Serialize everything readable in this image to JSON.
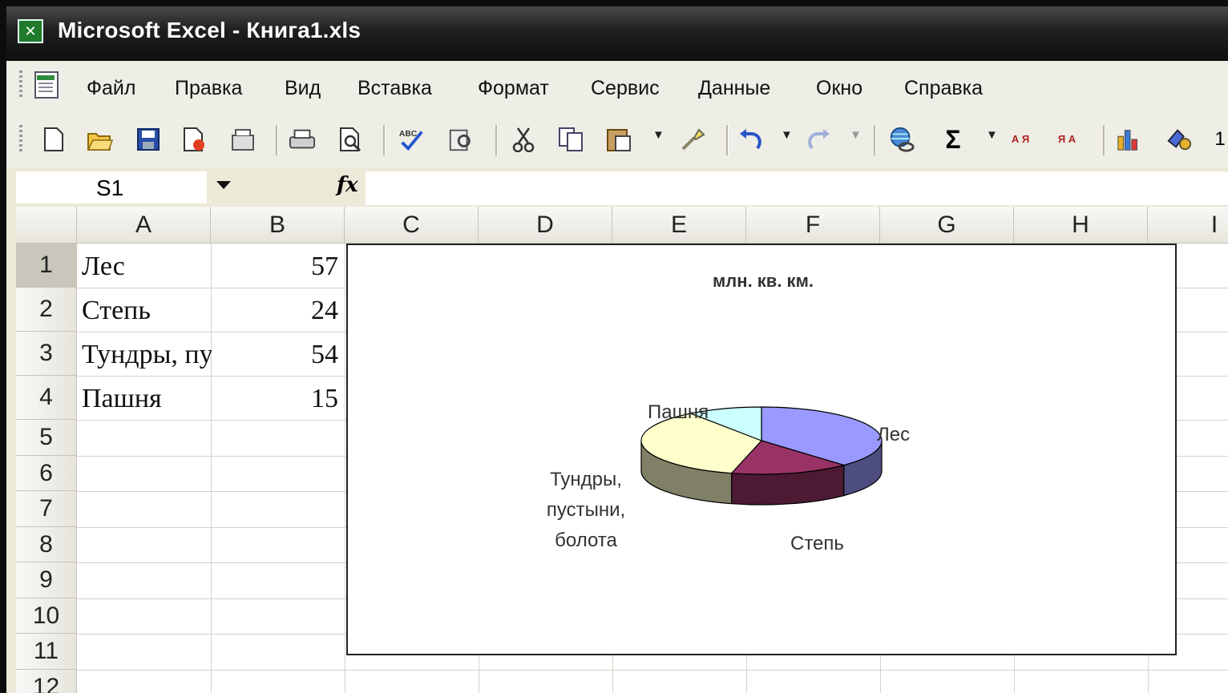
{
  "window": {
    "title": "Microsoft Excel - Книга1.xls",
    "app_icon": "excel-icon"
  },
  "menu": [
    "Файл",
    "Правка",
    "Вид",
    "Вставка",
    "Формат",
    "Сервис",
    "Данные",
    "Окно",
    "Справка"
  ],
  "toolbar": {
    "icons": [
      "new-icon",
      "open-icon",
      "save-icon",
      "permission-icon",
      "email-icon",
      "print-icon",
      "print-preview-icon",
      "spelling-icon",
      "research-icon",
      "cut-icon",
      "copy-icon",
      "paste-icon",
      "format-painter-icon",
      "undo-icon",
      "redo-icon",
      "hyperlink-icon",
      "autosum-icon",
      "sort-ascending-icon",
      "sort-descending-icon",
      "chart-wizard-icon",
      "drawing-icon"
    ],
    "autosum_symbol": "Σ",
    "sort_asc_label": "А Я",
    "sort_desc_label": "Я А",
    "zoom_partial": "1"
  },
  "formula_bar": {
    "name_box": "S1",
    "fx": "fx",
    "value": ""
  },
  "sheet": {
    "columns": [
      "A",
      "B",
      "C",
      "D",
      "E",
      "F",
      "G",
      "H",
      "I"
    ],
    "rows": [
      "1",
      "2",
      "3",
      "4",
      "5",
      "6",
      "7",
      "8",
      "9",
      "10",
      "11",
      "12"
    ],
    "selected_row": "1",
    "cells": {
      "A1": "Лес",
      "B1": "57",
      "A2": "Степь",
      "B2": "24",
      "A3": "Тундры, пустыни, болота",
      "B3": "54",
      "A4": "Пашня",
      "B4": "15"
    }
  },
  "chart_data": {
    "type": "pie",
    "title": "млн. кв. км.",
    "categories": [
      "Лес",
      "Степь",
      "Тундры, пустыни, болота",
      "Пашня"
    ],
    "values": [
      57,
      24,
      54,
      15
    ],
    "colors": [
      "#9999ff",
      "#993366",
      "#ffffcc",
      "#ccffff"
    ],
    "labels": {
      "les": "Лес",
      "step": "Степь",
      "tundra_line1": "Тундры,",
      "tundra_line2": "пустыни,",
      "tundra_line3": "болота",
      "pashnya": "Пашня"
    },
    "three_d": true
  }
}
